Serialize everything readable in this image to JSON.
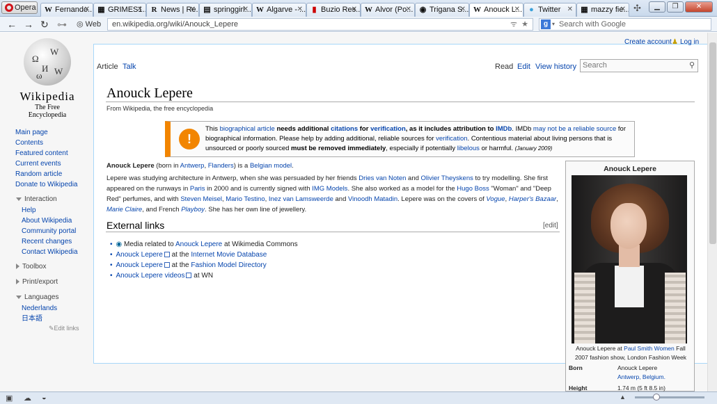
{
  "browser": {
    "menu_label": "Opera",
    "tabs": [
      {
        "title": "Fernando...",
        "fav": "W"
      },
      {
        "title": "GRIMES1....",
        "fav": "▦"
      },
      {
        "title": "News | Re...",
        "fav": "R"
      },
      {
        "title": "springgirl...",
        "fav": "▤"
      },
      {
        "title": "Algarve - ...",
        "fav": "W"
      },
      {
        "title": "Buzio Res...",
        "fav": "▮"
      },
      {
        "title": "Alvor (Po...",
        "fav": "W"
      },
      {
        "title": "Trigana S...",
        "fav": "◉"
      },
      {
        "title": "Anouck L...",
        "fav": "W"
      },
      {
        "title": "Twitter",
        "fav": "🐦"
      },
      {
        "title": "mazzy fie...",
        "fav": "▦"
      }
    ],
    "web_label": "Web",
    "url": "en.wikipedia.org/wiki/Anouck_Lepere",
    "search_placeholder": "Search with Google"
  },
  "wiki": {
    "logo_title": "Wikipedia",
    "logo_subtitle": "The Free Encyclopedia",
    "nav": [
      "Main page",
      "Contents",
      "Featured content",
      "Current events",
      "Random article",
      "Donate to Wikipedia"
    ],
    "interaction_label": "Interaction",
    "interaction": [
      "Help",
      "About Wikipedia",
      "Community portal",
      "Recent changes",
      "Contact Wikipedia"
    ],
    "toolbox_label": "Toolbox",
    "printexport_label": "Print/export",
    "languages_label": "Languages",
    "languages": [
      "Nederlands",
      "日本語"
    ],
    "edit_links": "Edit links",
    "create_account": "Create account",
    "login": "Log in",
    "tab_article": "Article",
    "tab_talk": "Talk",
    "tab_read": "Read",
    "tab_edit": "Edit",
    "tab_history": "View history",
    "search_placeholder": "Search"
  },
  "article": {
    "title": "Anouck Lepere",
    "from": "From Wikipedia, the free encyclopedia",
    "notice": {
      "t1": "This ",
      "l1": "biographical article",
      "b1": " needs additional ",
      "l2": "citations",
      "b2": " for ",
      "l3": "verification",
      "b3": ", as it includes attribution to ",
      "l4": "IMDb",
      "t2": ". IMDb ",
      "l5": "may not be a reliable source",
      "t3": " for biographical information. Please help by adding additional, reliable sources for ",
      "l6": "verification",
      "t4": ". Contentious material about living persons that is unsourced or poorly sourced ",
      "b4": "must be removed immediately",
      "t5": ", especially if potentially ",
      "l7": "libelous",
      "t6": " or harmful. ",
      "date": "(January 2009)"
    },
    "p1": {
      "name": "Anouck Lepere",
      "t1": " (born in ",
      "l1": "Antwerp",
      "t2": ", ",
      "l2": "Flanders",
      "t3": ") is a ",
      "l3": "Belgian model",
      "t4": "."
    },
    "p2": {
      "t1": "Lepere was studying architecture in Antwerp, when she was persuaded by her friends ",
      "l1": "Dries van Noten",
      "t2": " and ",
      "l2": "Olivier Theyskens",
      "t3": " to try modelling. She first appeared on the runways in ",
      "l3": "Paris",
      "t4": " in 2000 and is currently signed with ",
      "l4": "IMG Models",
      "t5": ". She also worked as a model for the ",
      "l5": "Hugo Boss",
      "t6": " \"Woman\" and \"Deep Red\" perfumes, and with ",
      "l6": "Steven Meisel",
      "t7": ", ",
      "l7": "Mario Testino",
      "t8": ", ",
      "l8": "Inez van Lamsweerde",
      "t9": " and ",
      "l9": "Vinoodh Matadin",
      "t10": ". Lepere was on the covers of ",
      "l10": "Vogue",
      "t11": ", ",
      "l11": "Harper's Bazaar",
      "t12": ", ",
      "l12": "Marie Claire",
      "t13": ", and French ",
      "l13": "Playboy",
      "t14": ". She has her own line of jewellery."
    },
    "external_heading": "External links",
    "edit": "[edit]",
    "external": [
      {
        "pre": "Media related to ",
        "link": "Anouck Lepere",
        "post": " at Wikimedia Commons"
      },
      {
        "pre": "",
        "link": "Anouck Lepere",
        "mid": " at the ",
        "link2": "Internet Movie Database"
      },
      {
        "pre": "",
        "link": "Anouck Lepere",
        "mid": " at the ",
        "link2": "Fashion Model Directory"
      },
      {
        "pre": "",
        "link": "Anouck Lepere videos",
        "post": " at WN"
      }
    ]
  },
  "infobox": {
    "title": "Anouck Lepere",
    "caption_pre": "Anouck Lepere at ",
    "caption_link": "Paul Smith Women",
    "caption_post": " Fall 2007 fashion show, London Fashion Week",
    "born_label": "Born",
    "born_name": "Anouck Lepere",
    "born_place": "Antwerp, Belgium.",
    "height_label": "Height",
    "height_value": "1.74 m (5 ft 8.5 in)"
  }
}
